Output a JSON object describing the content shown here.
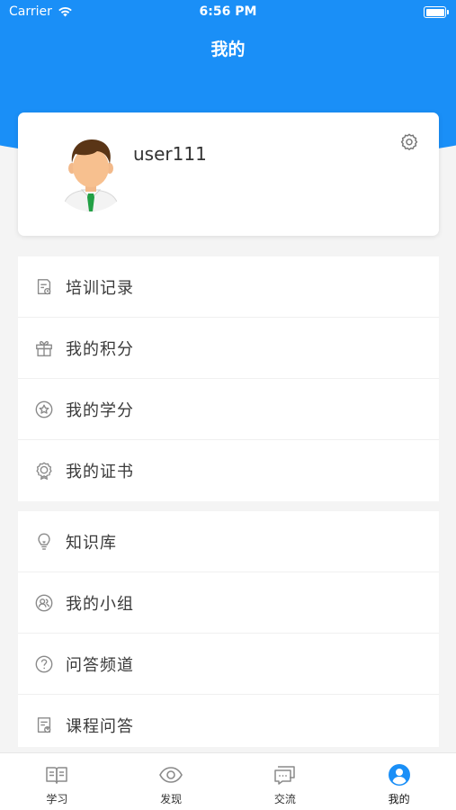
{
  "status_bar": {
    "carrier": "Carrier",
    "time": "6:56 PM"
  },
  "nav": {
    "title": "我的"
  },
  "profile": {
    "username": "user111",
    "settings_icon": "gear-icon"
  },
  "menu_groups": [
    {
      "items": [
        {
          "label": "培训记录",
          "icon": "training-record-icon"
        },
        {
          "label": "我的积分",
          "icon": "gift-icon"
        },
        {
          "label": "我的学分",
          "icon": "star-circle-icon"
        },
        {
          "label": "我的证书",
          "icon": "certificate-badge-icon"
        }
      ]
    },
    {
      "items": [
        {
          "label": "知识库",
          "icon": "lightbulb-icon"
        },
        {
          "label": "我的小组",
          "icon": "group-icon"
        },
        {
          "label": "问答频道",
          "icon": "question-circle-icon"
        },
        {
          "label": "课程问答",
          "icon": "course-qa-icon"
        }
      ]
    }
  ],
  "tab_bar": {
    "tabs": [
      {
        "label": "学习",
        "icon": "book-icon"
      },
      {
        "label": "发现",
        "icon": "eye-icon"
      },
      {
        "label": "交流",
        "icon": "chat-icon"
      },
      {
        "label": "我的",
        "icon": "user-icon"
      }
    ],
    "active_index": 3
  },
  "colors": {
    "primary": "#1a8ff7",
    "background": "#f4f4f4",
    "icon_gray": "#8a8a8a"
  }
}
